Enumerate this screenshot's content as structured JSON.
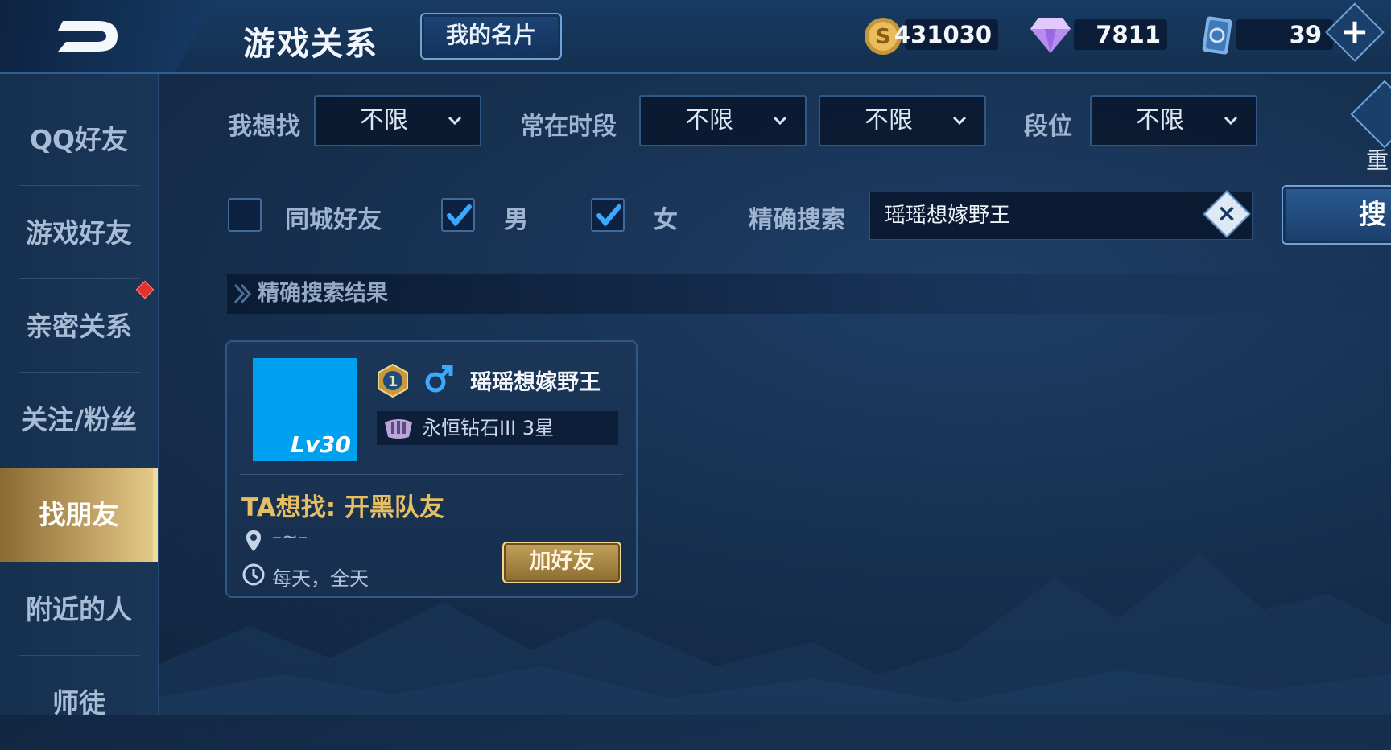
{
  "header": {
    "title": "游戏关系",
    "namecard_label": "我的名片",
    "currencies": [
      {
        "icon": "gold-coin-icon",
        "value": "431030"
      },
      {
        "icon": "diamond-icon",
        "value": "7811"
      },
      {
        "icon": "voucher-card-icon",
        "value": "39"
      }
    ]
  },
  "sidebar": {
    "items": [
      {
        "label": "QQ好友"
      },
      {
        "label": "游戏好友"
      },
      {
        "label": "亲密关系"
      },
      {
        "label": "关注/粉丝"
      },
      {
        "label": "找朋友"
      },
      {
        "label": "附近的人"
      },
      {
        "label": "师徒"
      }
    ],
    "active_index": 4
  },
  "filters": {
    "looking_for_label": "我想找",
    "looking_for_value": "不限",
    "active_time_label": "常在时段",
    "active_time_value_1": "不限",
    "active_time_value_2": "不限",
    "rank_label": "段位",
    "rank_value": "不限",
    "reset_label": "重",
    "same_city_label": "同城好友",
    "same_city_checked": false,
    "male_label": "男",
    "male_checked": true,
    "female_label": "女",
    "female_checked": true,
    "exact_search_label": "精确搜索",
    "exact_search_value": "瑶瑶想嫁野王",
    "search_button_label": "搜"
  },
  "results": {
    "header": "精确搜索结果",
    "card": {
      "level": "Lv30",
      "rank_badge_number": "1",
      "name": "瑶瑶想嫁野王",
      "tier": "永恒钻石III 3星",
      "wants": "TA想找: 开黑队友",
      "location": "–~–",
      "active_time": "每天，全天",
      "add_button_label": "加好友"
    }
  },
  "colors": {
    "accent_gold": "#e7bf63",
    "avatar_blue": "#00a0f0",
    "check_blue": "#3da8ff"
  }
}
